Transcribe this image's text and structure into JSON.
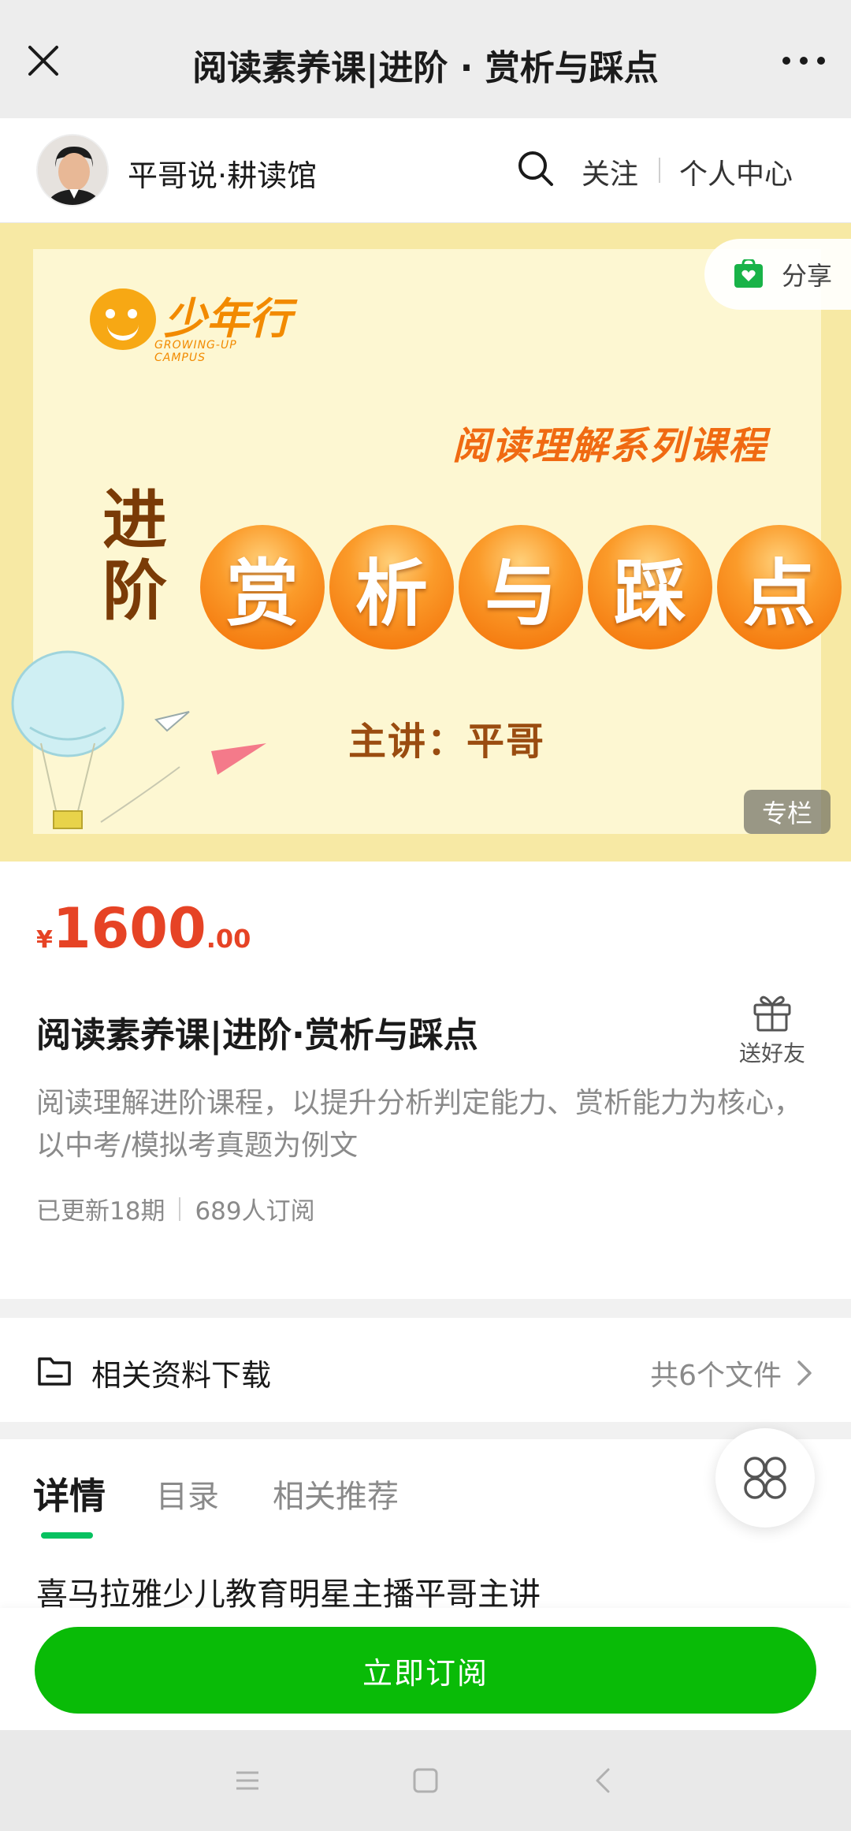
{
  "titlebar": {
    "title": "阅读素养课|进阶 · 赏析与踩点",
    "close_icon": "close-icon",
    "more_icon": "more-icon"
  },
  "account": {
    "name": "平哥说·耕读馆",
    "follow": "关注",
    "personal_center": "个人中心"
  },
  "banner": {
    "logo_text": "少年行",
    "logo_sub": "GROWING-UP CAMPUS",
    "series": "阅读理解系列课程",
    "advance": "进阶",
    "circles": [
      "赏",
      "析",
      "与",
      "踩",
      "点"
    ],
    "speaker": "主讲：平哥",
    "share": "分享",
    "tag": "专栏"
  },
  "price": {
    "currency": "¥",
    "integer": "1600",
    "decimal": ".00"
  },
  "course": {
    "title": "阅读素养课|进阶·赏析与踩点",
    "gift": "送好友",
    "description": "阅读理解进阶课程，以提升分析判定能力、赏析能力为核心，以中考/模拟考真题为例文",
    "updated": "已更新18期",
    "subscribers": "689人订阅"
  },
  "download": {
    "label": "相关资料下载",
    "count": "共6个文件"
  },
  "tabs": {
    "details": "详情",
    "catalog": "目录",
    "recommend": "相关推荐"
  },
  "intro": "喜马拉雅少儿教育明星主播平哥主讲",
  "subscribe": "立即订阅",
  "colors": {
    "accent_green": "#09bb07",
    "price_red": "#e64325",
    "banner_orange": "#f26e05"
  }
}
